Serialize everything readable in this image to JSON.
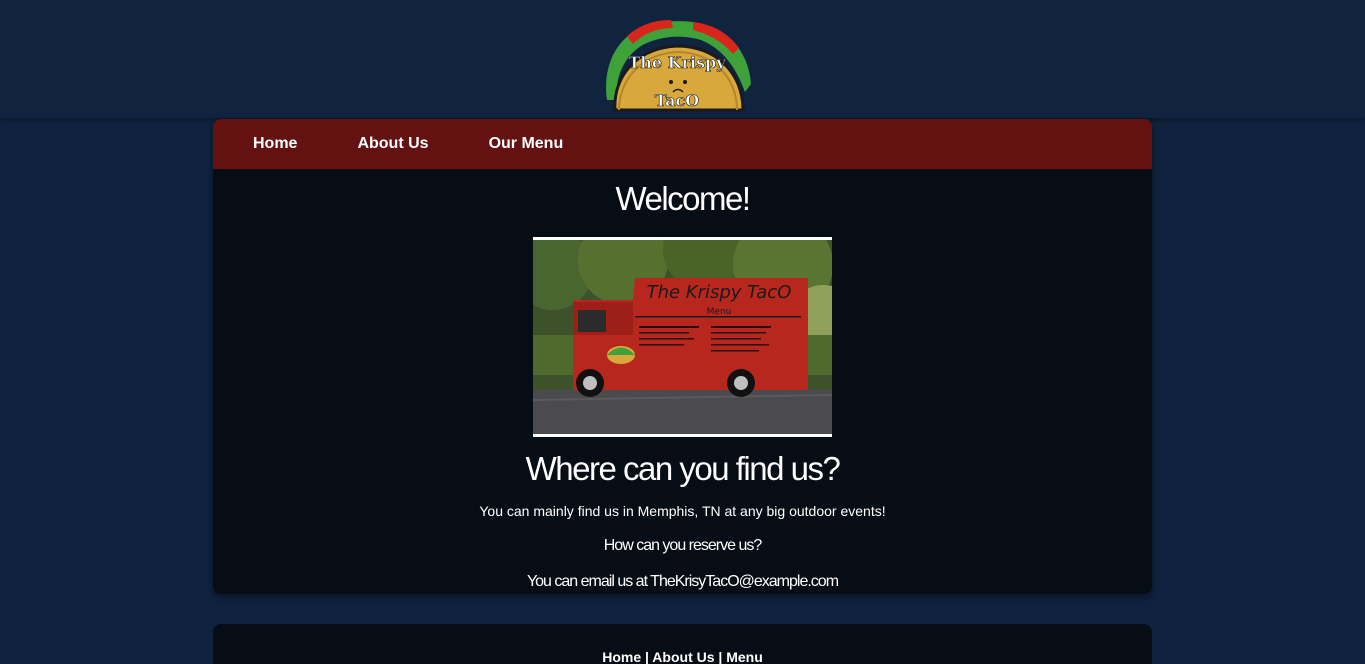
{
  "header": {
    "logo_line1": "The Krispy",
    "logo_line2": "TacO"
  },
  "nav": {
    "items": [
      {
        "label": "Home"
      },
      {
        "label": "About Us"
      },
      {
        "label": "Our Menu"
      }
    ]
  },
  "main": {
    "welcome_heading": "Welcome!",
    "truck_image": {
      "sign_title": "The Krispy TacO",
      "sign_subtitle": "Menu"
    },
    "where_heading": "Where can you find us?",
    "find_text": "You can mainly find us in Memphis, TN at any big outdoor events!",
    "reserve_text": "How can you reserve us?",
    "email_text": "You can email us at TheKrisyTacO@example.com"
  },
  "footer": {
    "links": [
      {
        "label": "Home"
      },
      {
        "label": "About Us"
      },
      {
        "label": "Menu"
      }
    ],
    "separator": " | "
  },
  "colors": {
    "page_background": "#0f2340",
    "nav_background": "#631111",
    "card_background": "#070d14",
    "text": "#ffffff"
  }
}
